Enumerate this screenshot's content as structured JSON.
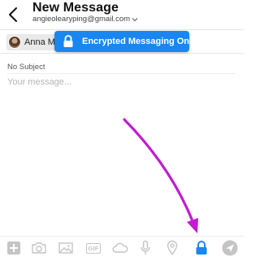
{
  "header": {
    "title": "New Message",
    "sender": "angieolearyping@gmail.com"
  },
  "recipients": [
    {
      "name": "Anna Ma"
    }
  ],
  "toast": {
    "text": "Encrypted Messaging On"
  },
  "compose": {
    "subject": "No Subject",
    "message_placeholder": "Your message..."
  },
  "toolbar": {
    "icons": [
      "add-icon",
      "camera-icon",
      "photo-icon",
      "gif-icon",
      "cloud-icon",
      "microphone-icon",
      "location-icon",
      "lock-icon",
      "send-icon"
    ],
    "gif_label": "GIF"
  },
  "colors": {
    "accent": "#1a86f0",
    "annotation_arrow": "#c21bd0",
    "toolbar_icon": "#c4c4c4"
  }
}
